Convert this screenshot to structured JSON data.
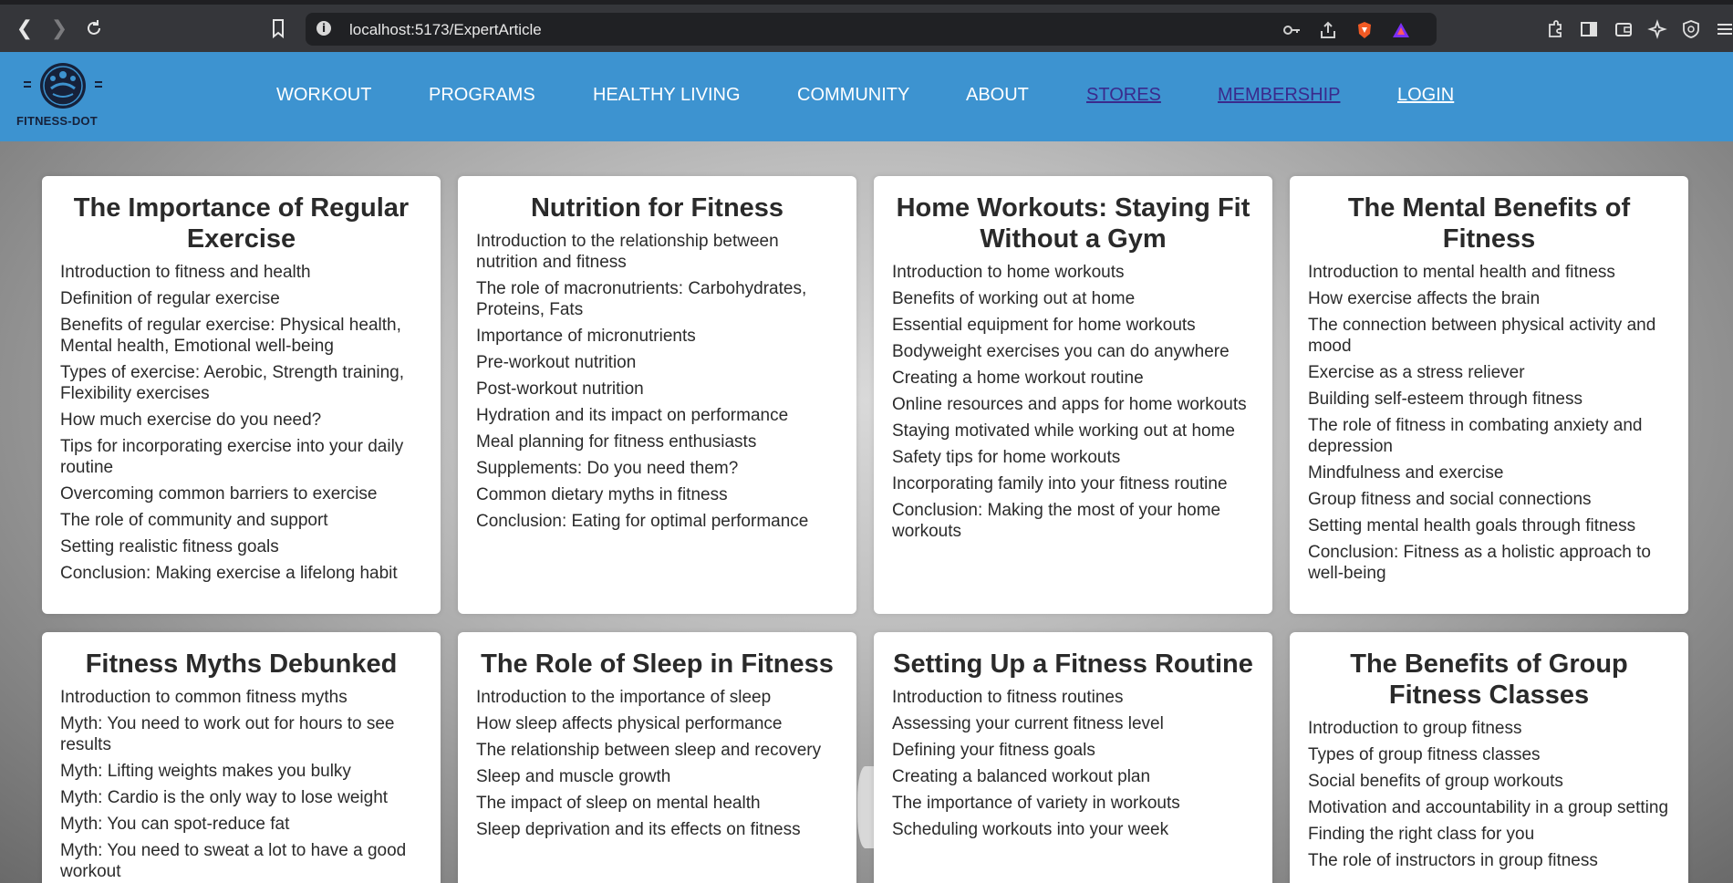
{
  "browser": {
    "url": "localhost:5173/ExpertArticle",
    "back_icon": "back-arrow-icon",
    "forward_icon": "forward-arrow-icon",
    "reload_icon": "reload-icon"
  },
  "site": {
    "logo_text": "FITNESS-DOT",
    "brand_color": "#3d93d0",
    "nav": [
      {
        "label": "WORKOUT"
      },
      {
        "label": "PROGRAMS"
      },
      {
        "label": "HEALTHY LIVING"
      },
      {
        "label": "COMMUNITY"
      },
      {
        "label": "ABOUT"
      },
      {
        "label": "STORES"
      },
      {
        "label": "MEMBERSHIP"
      },
      {
        "label": "LOGIN"
      }
    ]
  },
  "articles": [
    {
      "title": "The Importance of Regular Exercise",
      "items": [
        "Introduction to fitness and health",
        "Definition of regular exercise",
        "Benefits of regular exercise: Physical health, Mental health, Emotional well-being",
        "Types of exercise: Aerobic, Strength training, Flexibility exercises",
        "How much exercise do you need?",
        "Tips for incorporating exercise into your daily routine",
        "Overcoming common barriers to exercise",
        "The role of community and support",
        "Setting realistic fitness goals",
        "Conclusion: Making exercise a lifelong habit"
      ]
    },
    {
      "title": "Nutrition for Fitness",
      "items": [
        "Introduction to the relationship between nutrition and fitness",
        "The role of macronutrients: Carbohydrates, Proteins, Fats",
        "Importance of micronutrients",
        "Pre-workout nutrition",
        "Post-workout nutrition",
        "Hydration and its impact on performance",
        "Meal planning for fitness enthusiasts",
        "Supplements: Do you need them?",
        "Common dietary myths in fitness",
        "Conclusion: Eating for optimal performance"
      ]
    },
    {
      "title": "Home Workouts: Staying Fit Without a Gym",
      "items": [
        "Introduction to home workouts",
        "Benefits of working out at home",
        "Essential equipment for home workouts",
        "Bodyweight exercises you can do anywhere",
        "Creating a home workout routine",
        "Online resources and apps for home workouts",
        "Staying motivated while working out at home",
        "Safety tips for home workouts",
        "Incorporating family into your fitness routine",
        "Conclusion: Making the most of your home workouts"
      ]
    },
    {
      "title": "The Mental Benefits of Fitness",
      "items": [
        "Introduction to mental health and fitness",
        "How exercise affects the brain",
        "The connection between physical activity and mood",
        "Exercise as a stress reliever",
        "Building self-esteem through fitness",
        "The role of fitness in combating anxiety and depression",
        "Mindfulness and exercise",
        "Group fitness and social connections",
        "Setting mental health goals through fitness",
        "Conclusion: Fitness as a holistic approach to well-being"
      ]
    },
    {
      "title": "Fitness Myths Debunked",
      "items": [
        "Introduction to common fitness myths",
        "Myth: You need to work out for hours to see results",
        "Myth: Lifting weights makes you bulky",
        "Myth: Cardio is the only way to lose weight",
        "Myth: You can spot-reduce fat",
        "Myth: You need to sweat a lot to have a good workout"
      ]
    },
    {
      "title": "The Role of Sleep in Fitness",
      "items": [
        "Introduction to the importance of sleep",
        "How sleep affects physical performance",
        "The relationship between sleep and recovery",
        "Sleep and muscle growth",
        "The impact of sleep on mental health",
        "Sleep deprivation and its effects on fitness"
      ]
    },
    {
      "title": "Setting Up a Fitness Routine",
      "items": [
        "Introduction to fitness routines",
        "Assessing your current fitness level",
        "Defining your fitness goals",
        "Creating a balanced workout plan",
        "The importance of variety in workouts",
        "Scheduling workouts into your week"
      ]
    },
    {
      "title": "The Benefits of Group Fitness Classes",
      "items": [
        "Introduction to group fitness",
        "Types of group fitness classes",
        "Social benefits of group workouts",
        "Motivation and accountability in a group setting",
        "Finding the right class for you",
        "The role of instructors in group fitness"
      ]
    }
  ]
}
